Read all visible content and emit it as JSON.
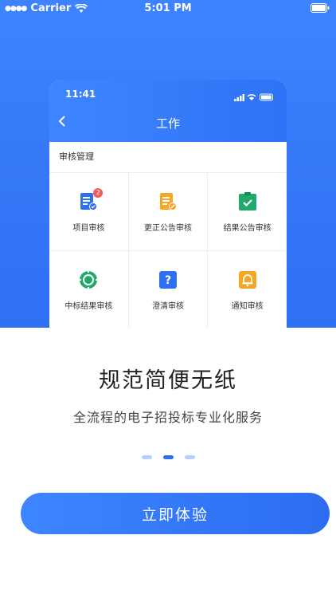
{
  "status_bar": {
    "carrier": "Carrier",
    "time": "5:01 PM"
  },
  "preview": {
    "time": "11:41",
    "title": "工作",
    "section_title": "审核管理",
    "items": [
      {
        "label": "项目审核",
        "icon": "document-check-icon",
        "badge": "2"
      },
      {
        "label": "更正公告审核",
        "icon": "document-edit-icon"
      },
      {
        "label": "结果公告审核",
        "icon": "clipboard-check-icon"
      },
      {
        "label": "中标结果审核",
        "icon": "target-icon"
      },
      {
        "label": "澄清审核",
        "icon": "question-icon"
      },
      {
        "label": "通知审核",
        "icon": "bell-icon"
      }
    ]
  },
  "headline": "规范简便无纸",
  "subline": "全流程的电子招投标专业化服务",
  "pager": {
    "count": 3,
    "active": 1
  },
  "cta_label": "立即体验",
  "colors": {
    "primary": "#2f6ff2",
    "badge": "#f25b5b",
    "green": "#1faa6b",
    "orange": "#f5a623"
  }
}
